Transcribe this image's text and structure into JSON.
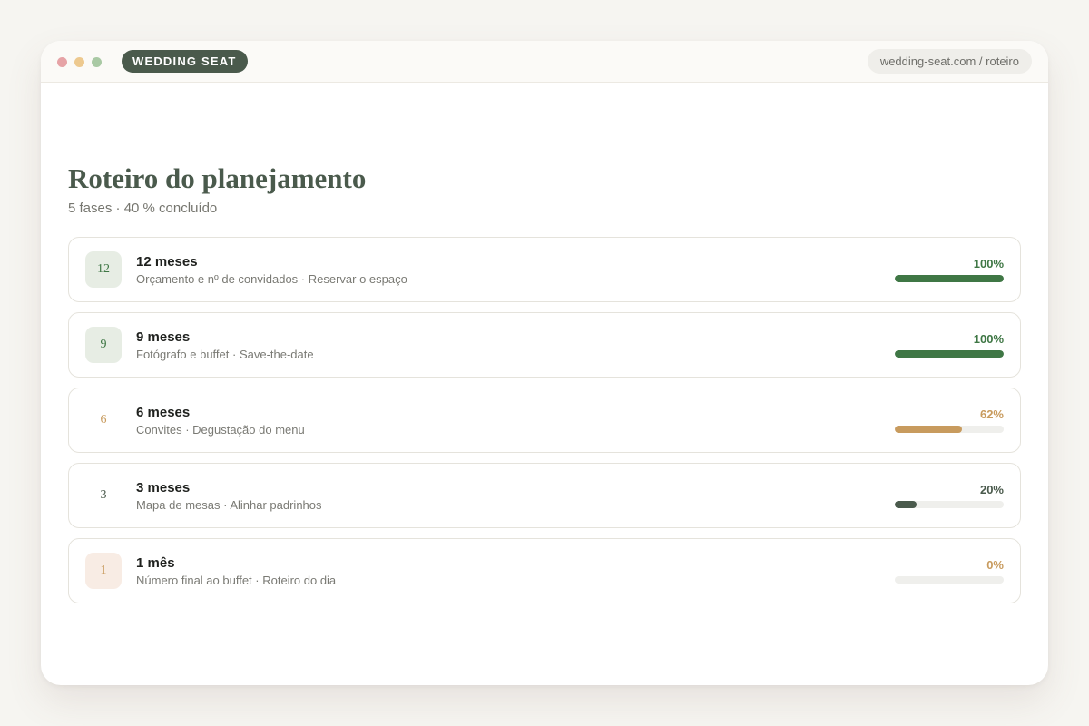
{
  "window": {
    "dots": [
      "#e6a3a6",
      "#edc98f",
      "#a9c9a4"
    ],
    "brand_label": "WEDDING SEAT",
    "brand_color": "#4a5a4c",
    "url": "wedding-seat.com / roteiro"
  },
  "page": {
    "title": "Roteiro do planejamento",
    "subtitle": "5 fases · 40 % concluído"
  },
  "phases": [
    {
      "badge": "12",
      "title": "12 meses",
      "tasks": "Orçamento e nº de convidados · Reservar o espaço",
      "percent_label": "100%",
      "progress": 100,
      "color": "#3f7745",
      "badge_bg": "#e7ede4",
      "badge_color": "#3f7745"
    },
    {
      "badge": "9",
      "title": "9 meses",
      "tasks": "Fotógrafo e buffet · Save-the-date",
      "percent_label": "100%",
      "progress": 100,
      "color": "#3f7745",
      "badge_bg": "#e7ede4",
      "badge_color": "#3f7745"
    },
    {
      "badge": "6",
      "title": "6 meses",
      "tasks": "Convites · Degustação do menu",
      "percent_label": "62%",
      "progress": 62,
      "color": "#c89b5e",
      "badge_bg": "#ffffff",
      "badge_color": "#c89b5e"
    },
    {
      "badge": "3",
      "title": "3 meses",
      "tasks": "Mapa de mesas · Alinhar padrinhos",
      "percent_label": "20%",
      "progress": 20,
      "color": "#4a5a4c",
      "badge_bg": "#ffffff",
      "badge_color": "#4a5a4c"
    },
    {
      "badge": "1",
      "title": "1 mês",
      "tasks": "Número final ao buffet · Roteiro do dia",
      "percent_label": "0%",
      "progress": 0,
      "color": "#c89b5e",
      "badge_bg": "#f8ece4",
      "badge_color": "#c89b5e"
    }
  ]
}
